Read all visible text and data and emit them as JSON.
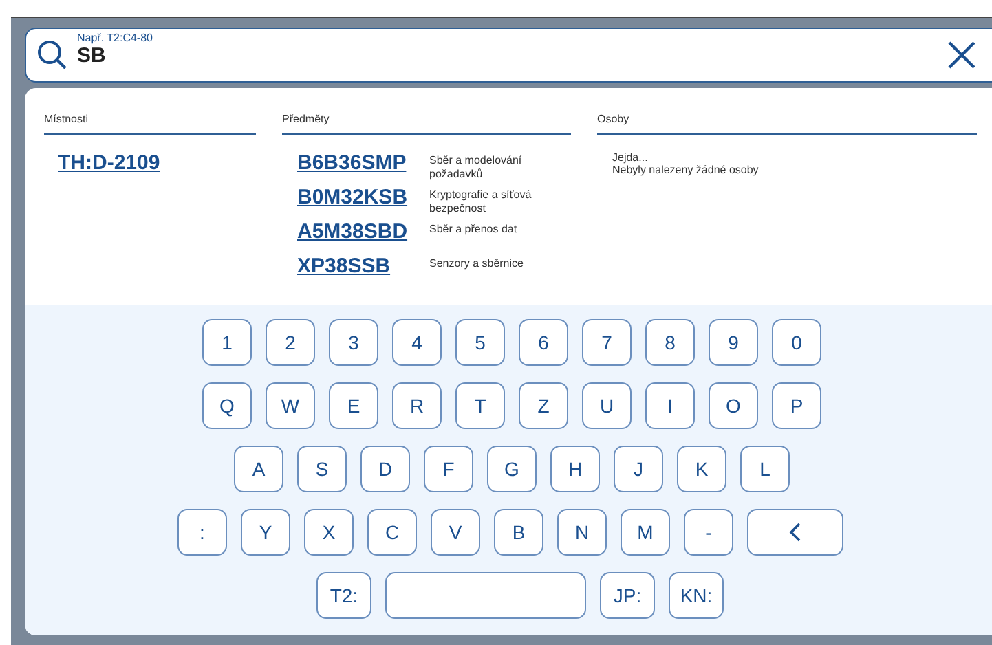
{
  "search": {
    "placeholder": "Např. T2:C4-80",
    "value": "SB"
  },
  "results": {
    "rooms": {
      "heading": "Místnosti",
      "items": [
        "TH:D-2109"
      ]
    },
    "courses": {
      "heading": "Předměty",
      "items": [
        {
          "code": "B6B36SMP",
          "name": "Sběr a modelování požadavků"
        },
        {
          "code": "B0M32KSB",
          "name": "Kryptografie a síťová bezpečnost"
        },
        {
          "code": "A5M38SBD",
          "name": "Sběr a přenos dat"
        },
        {
          "code": "XP38SSB",
          "name": "Senzory a sběrnice"
        }
      ]
    },
    "people": {
      "heading": "Osoby",
      "message": "Jejda...",
      "empty": "Nebyly nalezeny žádné osoby"
    }
  },
  "keyboard": [
    [
      {
        "kind": "char",
        "label": "1"
      },
      {
        "kind": "char",
        "label": "2"
      },
      {
        "kind": "char",
        "label": "3"
      },
      {
        "kind": "char",
        "label": "4"
      },
      {
        "kind": "char",
        "label": "5"
      },
      {
        "kind": "char",
        "label": "6"
      },
      {
        "kind": "char",
        "label": "7"
      },
      {
        "kind": "char",
        "label": "8"
      },
      {
        "kind": "char",
        "label": "9"
      },
      {
        "kind": "char",
        "label": "0"
      }
    ],
    [
      {
        "kind": "char",
        "label": "Q"
      },
      {
        "kind": "char",
        "label": "W"
      },
      {
        "kind": "char",
        "label": "E"
      },
      {
        "kind": "char",
        "label": "R"
      },
      {
        "kind": "char",
        "label": "T"
      },
      {
        "kind": "char",
        "label": "Z"
      },
      {
        "kind": "char",
        "label": "U"
      },
      {
        "kind": "char",
        "label": "I"
      },
      {
        "kind": "char",
        "label": "O"
      },
      {
        "kind": "char",
        "label": "P"
      }
    ],
    [
      {
        "kind": "char",
        "label": "A"
      },
      {
        "kind": "char",
        "label": "S"
      },
      {
        "kind": "char",
        "label": "D"
      },
      {
        "kind": "char",
        "label": "F"
      },
      {
        "kind": "char",
        "label": "G"
      },
      {
        "kind": "char",
        "label": "H"
      },
      {
        "kind": "char",
        "label": "J"
      },
      {
        "kind": "char",
        "label": "K"
      },
      {
        "kind": "char",
        "label": "L"
      }
    ],
    [
      {
        "kind": "char",
        "label": ":"
      },
      {
        "kind": "char",
        "label": "Y"
      },
      {
        "kind": "char",
        "label": "X"
      },
      {
        "kind": "char",
        "label": "C"
      },
      {
        "kind": "char",
        "label": "V"
      },
      {
        "kind": "char",
        "label": "B"
      },
      {
        "kind": "char",
        "label": "N"
      },
      {
        "kind": "char",
        "label": "M"
      },
      {
        "kind": "char",
        "label": "-"
      },
      {
        "kind": "backspace"
      }
    ],
    [
      {
        "kind": "char",
        "label": "T2:"
      },
      {
        "kind": "space"
      },
      {
        "kind": "char",
        "label": "JP:"
      },
      {
        "kind": "char",
        "label": "KN:"
      }
    ]
  ]
}
